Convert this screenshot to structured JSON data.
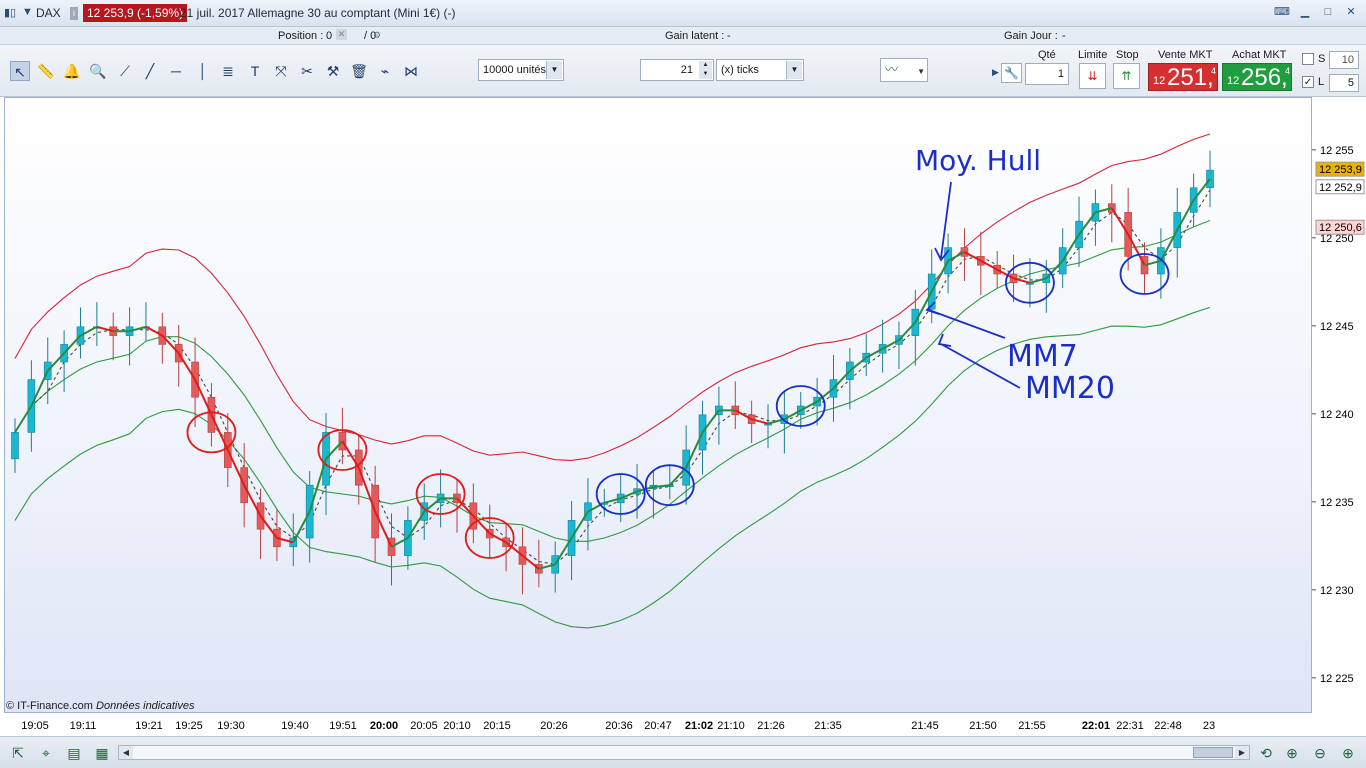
{
  "title_bar": {
    "symbol": "DAX",
    "price_change": "12 253,9 (-1,59%)",
    "description": "21 juil. 2017 Allemagne 30 au comptant (Mini 1€) (-)",
    "info_icon": "i",
    "icons": [
      "chart-window-icon",
      "dropdown-icon",
      "keyboard-icon",
      "minimize-icon",
      "maximize-icon",
      "close-icon"
    ]
  },
  "position_bar": {
    "position_label": "Position :",
    "position_value": "0",
    "position_slash_value": "/ 0",
    "gain_latent_label": "Gain latent :",
    "gain_latent_value": "-",
    "gain_jour_label": "Gain Jour :",
    "gain_jour_value": "-"
  },
  "toolbar": {
    "units_value": "10000 unités",
    "ticks_value": "21",
    "ticks_unit": "(x) ticks",
    "tools": [
      "cursor-icon",
      "ruler-icon",
      "alert-bell-icon",
      "zoom-icon",
      "line-icon",
      "segment-icon",
      "horizontal-line-icon",
      "vertical-line-icon",
      "fibonacci-icon",
      "text-icon",
      "arrows-icon",
      "tools-icon",
      "hammer-icon",
      "trash-icon",
      "trendline-icon",
      "pattern-icon"
    ]
  },
  "order_panel": {
    "qty_label": "Qté",
    "qty_value": "1",
    "limit_label": "Limite",
    "stop_label": "Stop",
    "sell_label": "Vente MKT",
    "buy_label": "Achat MKT",
    "sell_price": {
      "prefix": "12",
      "main": "251,",
      "sup": "4"
    },
    "buy_price": {
      "prefix": "12",
      "main": "256,",
      "sup": "4"
    },
    "s_label": "S",
    "s_value": "10",
    "l_label": "L",
    "l_value": "5",
    "sell_color": "#d62f32",
    "buy_color": "#1f9d3f"
  },
  "chart": {
    "copyright": "© IT-Finance.com",
    "copyright_note": "Données indicatives",
    "annotations": [
      "Moy. Hull",
      "MM7",
      "MM20"
    ],
    "price_labels": [
      {
        "text": "12 253,9",
        "color": "#e8b400"
      },
      {
        "text": "12 252,9",
        "color": "#ffffff"
      },
      {
        "text": "12 250,6",
        "color": "#ffd4d4"
      }
    ]
  },
  "chart_data": {
    "type": "candlestick",
    "y_ticks": [
      "12 255",
      "12 250",
      "12 245",
      "12 240",
      "12 235",
      "12 230",
      "12 225"
    ],
    "ylim": [
      12223,
      12258
    ],
    "x_labels": [
      "19:05",
      "19:11",
      "19:21",
      "19:25",
      "19:30",
      "19:40",
      "19:51",
      "20:00",
      "20:05",
      "20:10",
      "20:15",
      "20:26",
      "20:36",
      "20:47",
      "21:02",
      "21:10",
      "21:26",
      "21:35",
      "21:45",
      "21:50",
      "21:55",
      "22:01",
      "22:31",
      "22:48",
      "23"
    ],
    "x_labels_bold": [
      "20:00",
      "21:02",
      "22:01"
    ],
    "series_colors": {
      "up": "#19b8d2",
      "down": "#e35a5a",
      "hull_up": "#2a8a3d",
      "hull_down": "#e01b1b",
      "bb_upper": "#d8243a",
      "bb_lower": "#2f9a3f",
      "mm20": "#2f9a3f"
    },
    "closes": [
      12239,
      12242,
      12243,
      12244,
      12245,
      12245,
      12244.5,
      12245,
      12245,
      12244,
      12243,
      12241,
      12239,
      12237,
      12235,
      12233.5,
      12232.5,
      12233,
      12236,
      12239,
      12238,
      12236,
      12233,
      12232,
      12234,
      12235,
      12235.5,
      12235,
      12233.5,
      12233,
      12232.5,
      12231.5,
      12231,
      12232,
      12234,
      12235,
      12235,
      12235.5,
      12235.8,
      12236,
      12236,
      12238,
      12240,
      12240.5,
      12240,
      12239.5,
      12239.5,
      12240,
      12240.5,
      12241,
      12242,
      12243,
      12243.5,
      12244,
      12244.5,
      12246,
      12248,
      12249.5,
      12249,
      12248.5,
      12248,
      12247.5,
      12247.5,
      12248,
      12249.5,
      12251,
      12252,
      12251.5,
      12249,
      12248,
      12249.5,
      12251.5,
      12252.9,
      12253.9
    ]
  }
}
